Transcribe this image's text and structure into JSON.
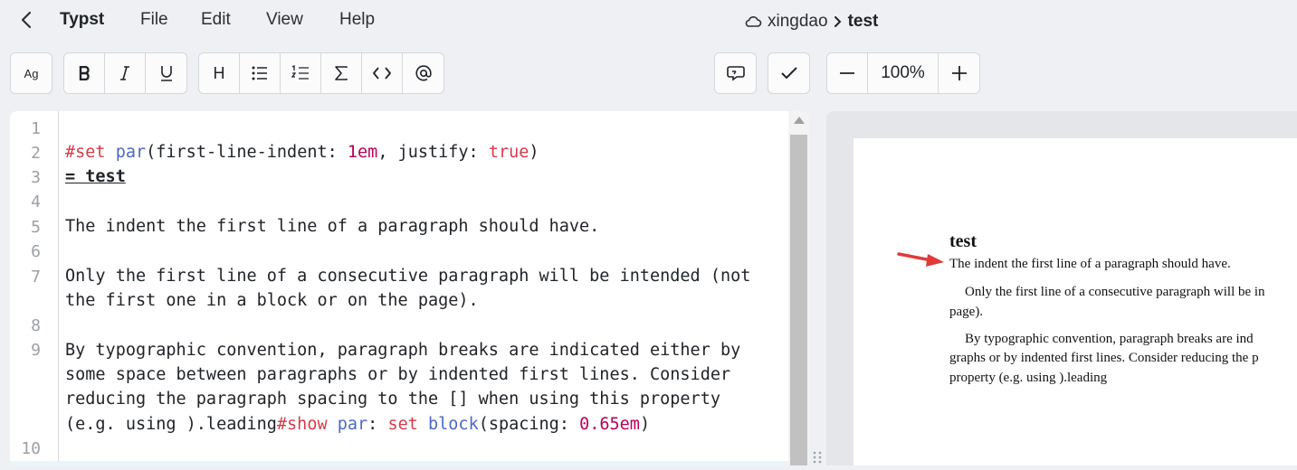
{
  "menubar": {
    "app_name": "Typst",
    "items": [
      "File",
      "Edit",
      "View",
      "Help"
    ],
    "breadcrumb": {
      "project": "xingdao",
      "file": "test"
    }
  },
  "toolbar": {
    "font_label": "Ag",
    "heading_label": "H",
    "zoom": "100%"
  },
  "editor": {
    "line_numbers": [
      "1",
      "2",
      "3",
      "4",
      "5",
      "6",
      "7",
      "8",
      "9",
      "10"
    ],
    "line2": {
      "kw": "#set",
      "fn": "par",
      "p1": "(first-line-indent: ",
      "num": "1em",
      "p2": ", justify: ",
      "bool": "true",
      "p3": ")"
    },
    "line3": "= test",
    "line5": "The indent the first line of a paragraph should have.",
    "line7a": "Only the first line of a consecutive paragraph will be intended (not",
    "line7b": "the first one in a block or on the page).",
    "line9a": "By typographic convention, paragraph breaks are indicated either by",
    "line9b": "some space between paragraphs or by indented first lines. Consider",
    "line9c": "reducing the paragraph spacing to the [] when using this property",
    "line9d": {
      "p1": "(e.g. using ).leading",
      "kw1": "#show",
      "fn1": "par",
      "p2": ": ",
      "kw2": "set",
      "fn2": "block",
      "p3": "(spacing: ",
      "num": "0.65em",
      "p4": ")"
    }
  },
  "preview": {
    "title": "test",
    "lines": [
      "The indent the first line of a paragraph should have.",
      "Only the first line of a consecutive paragraph will be in",
      "page).",
      "By typographic convention, paragraph breaks are ind",
      "graphs or by indented first lines. Consider reducing the p",
      "property (e.g. using ).leading"
    ]
  },
  "colors": {
    "keyword": "#d73a49",
    "function": "#4b69c6",
    "number": "#b60157",
    "arrow": "#e03a3a"
  }
}
